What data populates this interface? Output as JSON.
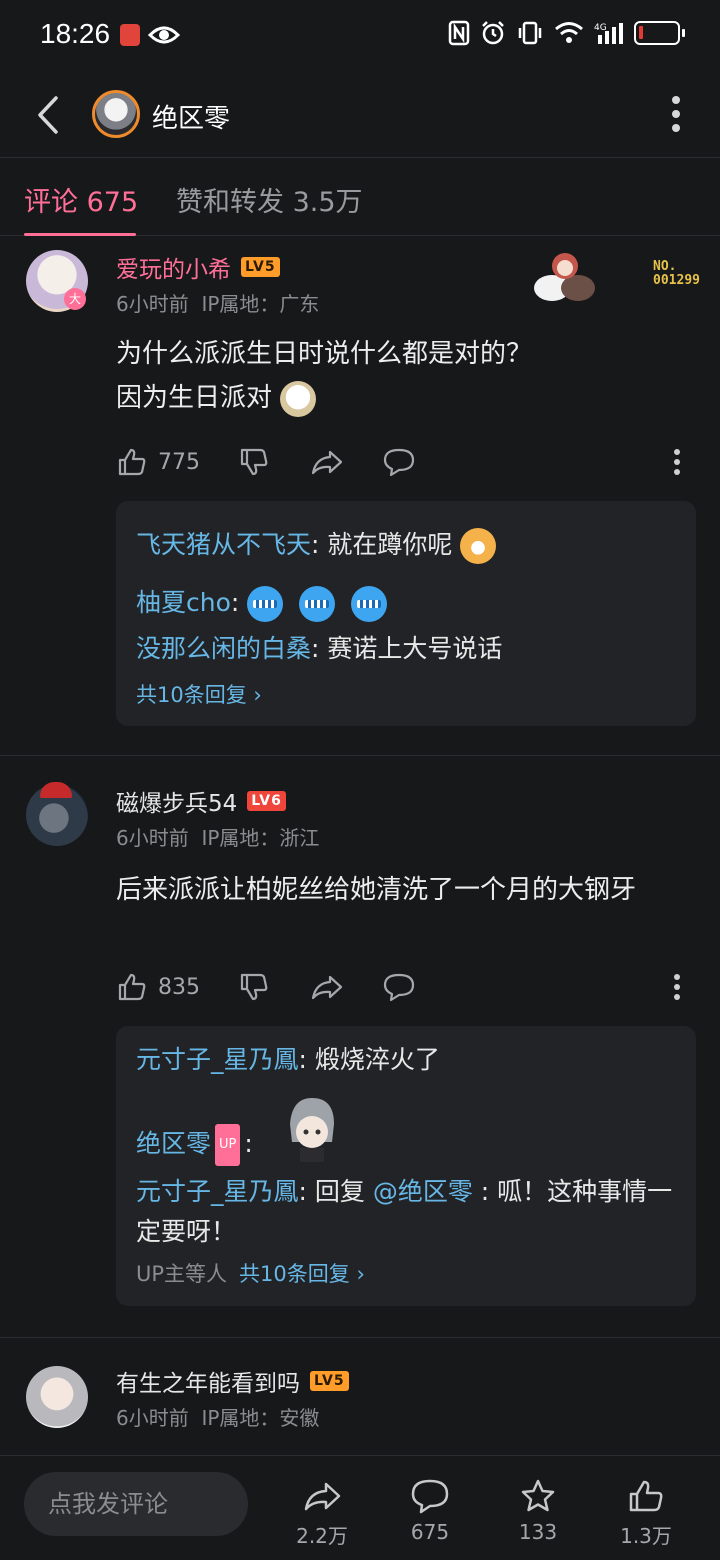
{
  "status": {
    "time": "18:26",
    "network": "4G"
  },
  "header": {
    "title": "绝区零"
  },
  "tabs": {
    "comments": "评论 675",
    "likes": "赞和转发 3.5万"
  },
  "comments": [
    {
      "username": "爱玩的小希",
      "level": "LV5",
      "time": "6小时前",
      "ip": "IP属地：广东",
      "fan_no_label": "NO.",
      "fan_no": "001299",
      "content_line1": "为什么派派生日时说什么都是对的？",
      "content_line2": "因为生日派对",
      "likes": "775",
      "replies": [
        {
          "name": "飞天猪从不飞天",
          "text": ": 就在蹲你呢"
        },
        {
          "name": "柚夏cho",
          "text": ":"
        },
        {
          "name": "没那么闲的白桑",
          "text": ": 赛诺上大号说话"
        }
      ],
      "more": "共10条回复 ›"
    },
    {
      "username": "磁爆步兵54",
      "level": "LV6",
      "time": "6小时前",
      "ip": "IP属地：浙江",
      "content": "后来派派让柏妮丝给她清洗了一个月的大钢牙",
      "likes": "835",
      "replies": [
        {
          "name": "元寸子_星乃鳳",
          "text": ": 煅烧淬火了"
        },
        {
          "name": "绝区零",
          "badge": "UP",
          "text": ":"
        },
        {
          "name": "元寸子_星乃鳳",
          "text_prefix": ": 回复 ",
          "mention": "@绝区零",
          "text": " : 呱！这种事情一定要呀！"
        }
      ],
      "more_prefix": "UP主等人",
      "more": "共10条回复 ›"
    },
    {
      "username": "有生之年能看到吗",
      "level": "LV5",
      "time": "6小时前",
      "ip": "IP属地：安徽"
    }
  ],
  "bottom": {
    "input_placeholder": "点我发评论",
    "share_count": "2.2万",
    "comment_count": "675",
    "star_count": "133",
    "like_count": "1.3万"
  }
}
